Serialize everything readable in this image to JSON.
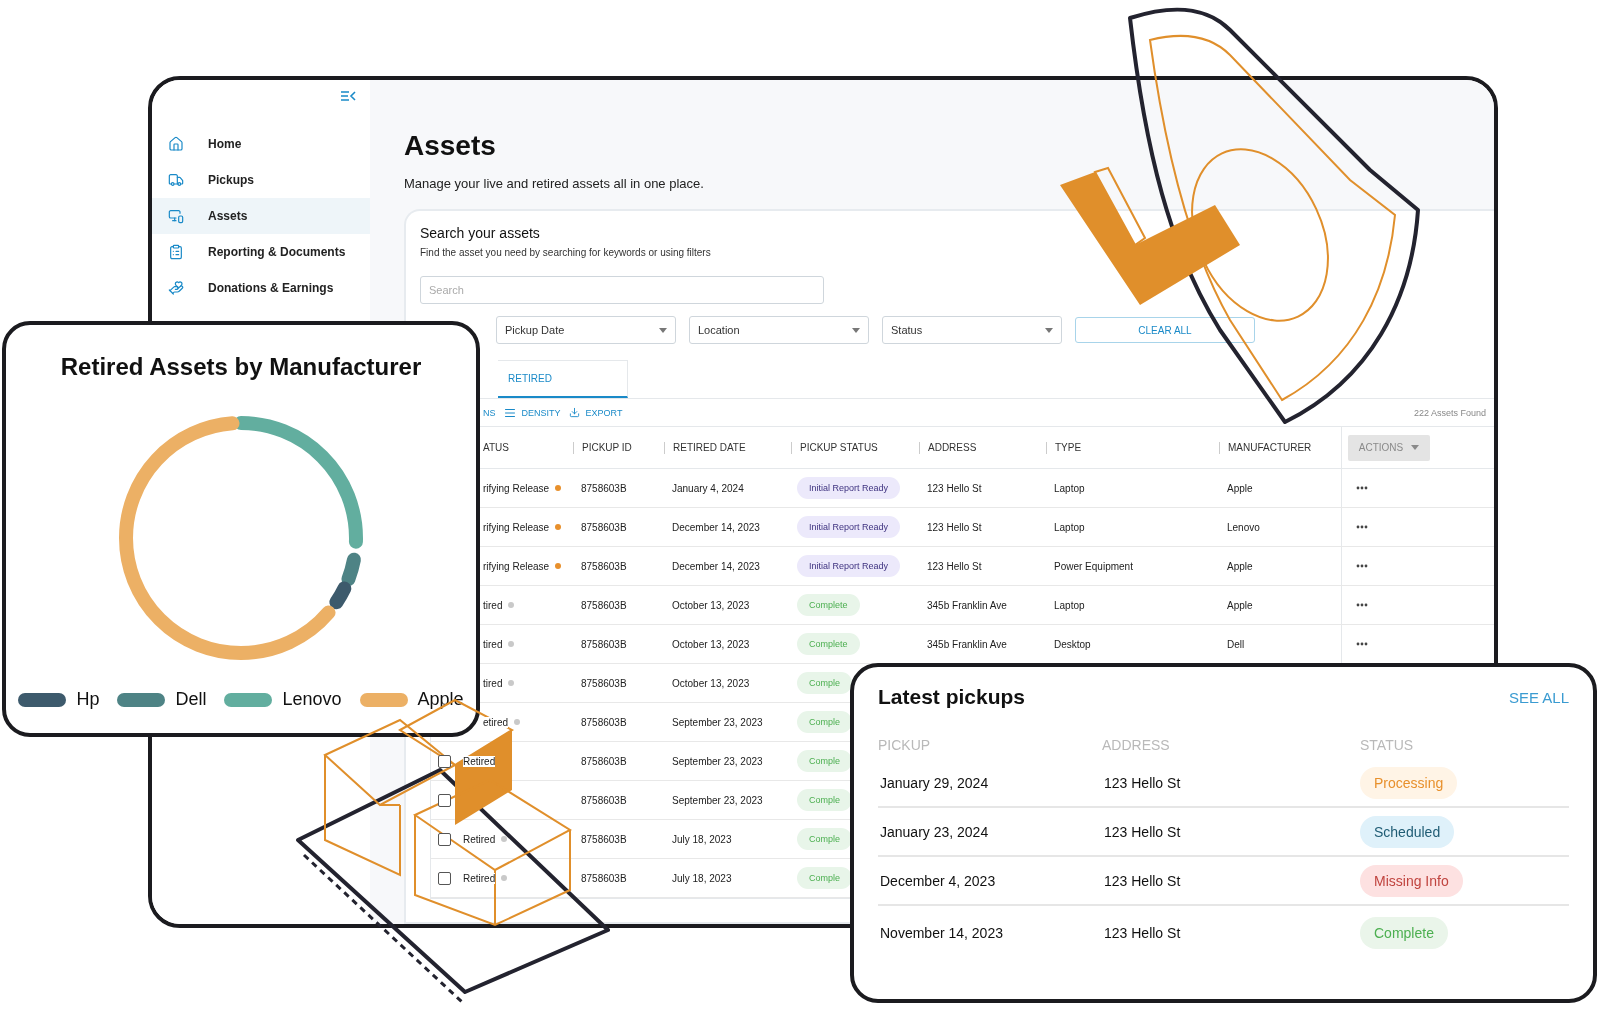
{
  "sidebar": {
    "items": [
      {
        "label": "Home",
        "kind": "home",
        "selected": false
      },
      {
        "label": "Pickups",
        "kind": "truck",
        "selected": false
      },
      {
        "label": "Assets",
        "kind": "devices",
        "selected": true
      },
      {
        "label": "Reporting & Documents",
        "kind": "list",
        "selected": false
      },
      {
        "label": "Donations & Earnings",
        "kind": "donation",
        "selected": false
      }
    ]
  },
  "page": {
    "title": "Assets",
    "subtitle": "Manage your live and retired assets all in one place."
  },
  "search_panel": {
    "title": "Search your assets",
    "subtitle": "Find the asset you need by searching for keywords or using filters",
    "search": {
      "placeholder": "Search"
    },
    "filters": [
      {
        "label": "Pickup Date"
      },
      {
        "label": "Location"
      },
      {
        "label": "Status"
      }
    ],
    "clear_button": "CLEAR ALL"
  },
  "tabs": [
    {
      "label": "RETIRED",
      "selected": true
    }
  ],
  "toolbar": [
    {
      "label": "NS",
      "kind": "plain"
    },
    {
      "label": "DENSITY",
      "kind": "density"
    },
    {
      "label": "EXPORT",
      "kind": "export"
    }
  ],
  "results_count": "222 Assets Found",
  "table": {
    "columns": [
      "ATUS",
      "PICKUP ID",
      "RETIRED DATE",
      "PICKUP STATUS",
      "ADDRESS",
      "TYPE",
      "MANUFACTURER"
    ],
    "actions_button": "ACTIONS",
    "rows": [
      {
        "kind": "partial",
        "status": "rifying Release",
        "color": "#e8902c",
        "pickup_id": "8758603B",
        "retired_date": "January 4, 2024",
        "pickup_status": {
          "label": "Initial Report Ready",
          "kind": "report"
        },
        "address": "123 Hello St",
        "type": "Laptop",
        "manufacturer": "Apple"
      },
      {
        "kind": "partial",
        "status": "rifying Release",
        "color": "#e8902c",
        "pickup_id": "8758603B",
        "retired_date": "December 14, 2023",
        "pickup_status": {
          "label": "Initial Report Ready",
          "kind": "report"
        },
        "address": "123 Hello St",
        "type": "Laptop",
        "manufacturer": "Lenovo"
      },
      {
        "kind": "partial",
        "status": "rifying Release",
        "color": "#e8902c",
        "pickup_id": "8758603B",
        "retired_date": "December 14, 2023",
        "pickup_status": {
          "label": "Initial Report Ready",
          "kind": "report"
        },
        "address": "123 Hello St",
        "type": "Power Equipment",
        "manufacturer": "Apple"
      },
      {
        "kind": "partial",
        "status": "tired",
        "color": "#c9c9c9",
        "pickup_id": "8758603B",
        "retired_date": "October 13, 2023",
        "pickup_status": {
          "label": "Complete",
          "kind": "complete"
        },
        "address": "345b Franklin Ave",
        "type": "Laptop",
        "manufacturer": "Apple"
      },
      {
        "kind": "partial",
        "status": "tired",
        "color": "#c9c9c9",
        "pickup_id": "8758603B",
        "retired_date": "October 13, 2023",
        "pickup_status": {
          "label": "Complete",
          "kind": "complete"
        },
        "address": "345b Franklin Ave",
        "type": "Desktop",
        "manufacturer": "Dell"
      },
      {
        "kind": "partial",
        "status": "tired",
        "color": "#c9c9c9",
        "pickup_id": "8758603B",
        "retired_date": "October 13, 2023",
        "pickup_status": {
          "label": "Comple",
          "kind": "complete"
        }
      },
      {
        "kind": "partial",
        "status": "etired",
        "color": "#c9c9c9",
        "pickup_id": "8758603B",
        "retired_date": "September 23, 2023",
        "pickup_status": {
          "label": "Comple",
          "kind": "complete"
        }
      },
      {
        "kind": "full",
        "checked": false,
        "status": "Retired",
        "pickup_id": "8758603B",
        "retired_date": "September 23, 2023",
        "pickup_status": {
          "label": "Comple",
          "kind": "complete"
        }
      },
      {
        "kind": "full",
        "checked": false,
        "pickup_id": "8758603B",
        "retired_date": "September 23, 2023",
        "pickup_status": {
          "label": "Comple",
          "kind": "complete"
        }
      },
      {
        "kind": "full",
        "checked": false,
        "status": "Retired",
        "color": "#c9c9c9",
        "pickup_id": "8758603B",
        "retired_date": "July 18, 2023",
        "pickup_status": {
          "label": "Comple",
          "kind": "complete"
        }
      },
      {
        "kind": "full",
        "checked": false,
        "status": "Retired",
        "color": "#c9c9c9",
        "pickup_id": "8758603B",
        "retired_date": "July 18, 2023",
        "pickup_status": {
          "label": "Comple",
          "kind": "complete"
        }
      }
    ]
  },
  "chart_card": {
    "title": "Retired Assets by Manufacturer",
    "legend": [
      {
        "label": "Hp",
        "color": "#3d5a6c"
      },
      {
        "label": "Dell",
        "color": "#4e8385"
      },
      {
        "label": "Lenovo",
        "color": "#62ae9f"
      },
      {
        "label": "Apple",
        "color": "#ecb065"
      }
    ]
  },
  "latest_pickups": {
    "title": "Latest pickups",
    "see_all": "SEE ALL",
    "columns": [
      "PICKUP",
      "ADDRESS",
      "STATUS"
    ],
    "rows": [
      {
        "pickup": "January 29, 2024",
        "address": "123 Hello St",
        "status": "Processing",
        "kind": "processing"
      },
      {
        "pickup": "January 23, 2024",
        "address": "123 Hello St",
        "status": "Scheduled",
        "kind": "scheduled"
      },
      {
        "pickup": "December 4, 2023",
        "address": "123 Hello St",
        "status": "Missing Info",
        "kind": "missing"
      },
      {
        "pickup": "November 14, 2023",
        "address": "123 Hello St",
        "status": "Complete",
        "kind": "complete"
      }
    ]
  }
}
